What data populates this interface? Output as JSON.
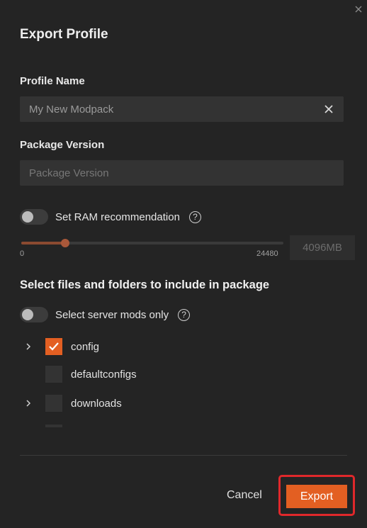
{
  "dialog": {
    "title": "Export Profile"
  },
  "profile_name": {
    "label": "Profile Name",
    "value": "My New Modpack"
  },
  "package_version": {
    "label": "Package Version",
    "placeholder": "Package Version"
  },
  "ram": {
    "toggle_label": "Set RAM recommendation",
    "help": "?",
    "slider_min": "0",
    "slider_max": "24480",
    "slider_value": 4096,
    "value_display": "4096MB",
    "enabled": false
  },
  "files": {
    "section_title": "Select files and folders to include in package",
    "server_toggle_label": "Select server mods only",
    "help": "?",
    "items": [
      {
        "name": "config",
        "checked": true,
        "expandable": true
      },
      {
        "name": "defaultconfigs",
        "checked": false,
        "expandable": false
      },
      {
        "name": "downloads",
        "checked": false,
        "expandable": true
      }
    ]
  },
  "actions": {
    "cancel_label": "Cancel",
    "export_label": "Export"
  },
  "colors": {
    "accent": "#e35f22",
    "background": "#242424",
    "input_bg": "#333333",
    "highlight_outline": "#e0282b"
  }
}
